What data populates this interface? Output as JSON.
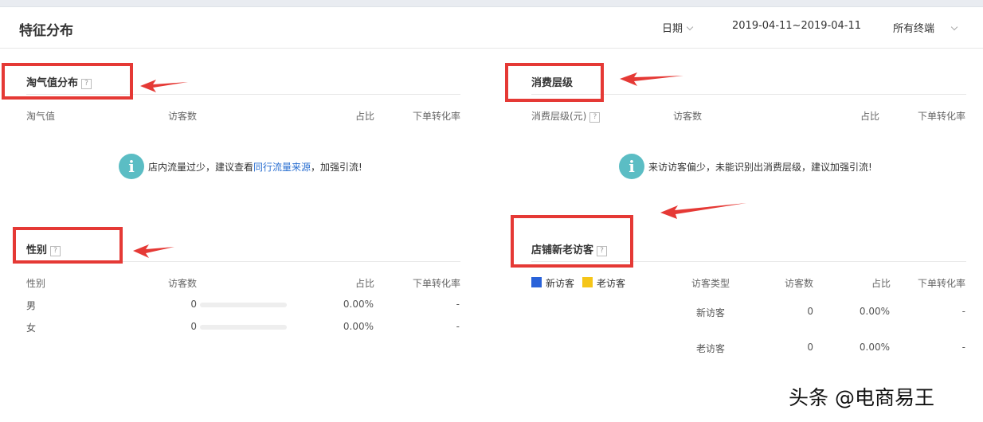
{
  "header": {
    "title": "特征分布",
    "date_label": "日期",
    "date_range": "2019-04-11~2019-04-11",
    "terminal_label": "所有终端"
  },
  "taoqi": {
    "title": "淘气值分布",
    "help": "?",
    "columns": [
      "淘气值",
      "访客数",
      "占比",
      "下单转化率"
    ],
    "tip_before": "店内流量过少，建议查看",
    "tip_link": "同行流量来源",
    "tip_after": "，加强引流!"
  },
  "consumption": {
    "title": "消费层级",
    "columns": [
      "消费层级(元)",
      "访客数",
      "占比",
      "下单转化率"
    ],
    "col0_help": "?",
    "tip": "来访访客偏少，未能识别出消费层级，建议加强引流!"
  },
  "gender": {
    "title": "性别",
    "help": "?",
    "columns": [
      "性别",
      "访客数",
      "占比",
      "下单转化率"
    ],
    "rows": [
      {
        "label": "男",
        "visitors": "0",
        "ratio": "0.00%",
        "conversion": "-",
        "bar_fraction": 0
      },
      {
        "label": "女",
        "visitors": "0",
        "ratio": "0.00%",
        "conversion": "-",
        "bar_fraction": 0
      }
    ]
  },
  "visitors": {
    "title": "店铺新老访客",
    "help": "?",
    "legend": [
      {
        "label": "新访客",
        "color": "#2962d9"
      },
      {
        "label": "老访客",
        "color": "#f5c518"
      }
    ],
    "columns": [
      "访客类型",
      "访客数",
      "占比",
      "下单转化率"
    ],
    "rows": [
      {
        "label": "新访客",
        "visitors": "0",
        "ratio": "0.00%",
        "conversion": "-"
      },
      {
        "label": "老访客",
        "visitors": "0",
        "ratio": "0.00%",
        "conversion": "-"
      }
    ]
  },
  "annotation_color": "#e53935",
  "watermark": "头条 @电商易王"
}
